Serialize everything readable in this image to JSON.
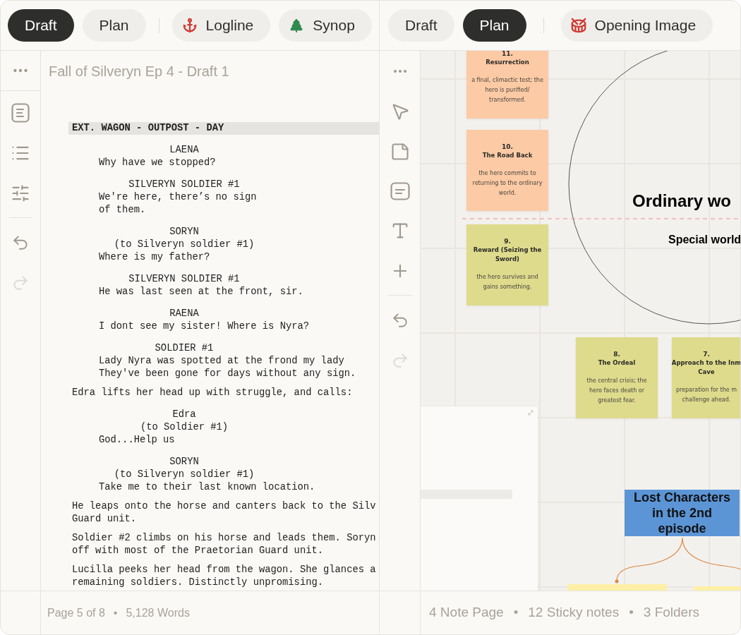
{
  "left_panel": {
    "tabs": [
      {
        "label": "Draft",
        "selected": true
      },
      {
        "label": "Plan",
        "selected": false
      }
    ],
    "chips": [
      {
        "label": "Logline"
      },
      {
        "label": "Synop"
      }
    ],
    "document_title": "Fall of Silveryn Ep 4 - Draft 1",
    "history": [
      {
        "kind": "undo",
        "disabled": false
      },
      {
        "kind": "redo",
        "disabled": true
      }
    ],
    "script": [
      {
        "kind": "heading",
        "text": "EXT. WAGON - OUTPOST - DAY"
      },
      {
        "kind": "speech",
        "character": "LAENA",
        "lines": [
          "Why have we stopped?"
        ]
      },
      {
        "kind": "speech",
        "character": "SILVERYN SOLDIER #1",
        "lines": [
          "We're here, there’s no sign",
          "of them."
        ]
      },
      {
        "kind": "speech",
        "character": "SORYN",
        "parenthetical": "(to Silveryn soldier #1)",
        "lines": [
          "Where is my father?"
        ]
      },
      {
        "kind": "speech",
        "character": "SILVERYN SOLDIER #1",
        "lines": [
          "He was last seen at the front, sir."
        ]
      },
      {
        "kind": "speech",
        "character": "RAENA",
        "lines": [
          "I dont see my sister! Where is Nyra?"
        ]
      },
      {
        "kind": "speech",
        "character": "SOLDIER #1",
        "lines": [
          "Lady Nyra was spotted at the frond my lady",
          "They've been gone for days without any sign."
        ]
      },
      {
        "kind": "action",
        "lines": [
          "Edra lifts her head up with struggle, and calls:"
        ]
      },
      {
        "kind": "speech",
        "character": "Edra",
        "parenthetical": "(to Soldier #1)",
        "lines": [
          "God...Help us"
        ]
      },
      {
        "kind": "speech",
        "character": "SORYN",
        "parenthetical": "(to Silveryn soldier #1)",
        "lines": [
          "Take me to their last known location."
        ]
      },
      {
        "kind": "action",
        "lines": [
          "He leaps onto the horse and canters back to the Silv",
          "Guard unit."
        ]
      },
      {
        "kind": "action",
        "lines": [
          "Soldier #2 climbs on his horse and leads them. Soryn",
          "off with most of the Praetorian Guard unit."
        ]
      },
      {
        "kind": "action",
        "lines": [
          "Lucilla peeks her head from the wagon. She glances a",
          "remaining soldiers. Distinctly unpromising."
        ]
      }
    ],
    "status": [
      "Page 5 of 8",
      "5,128 Words"
    ],
    "status_separator": "•"
  },
  "right_panel": {
    "tabs": [
      {
        "label": "Draft",
        "selected": false
      },
      {
        "label": "Plan",
        "selected": true
      }
    ],
    "chips": [
      {
        "label": "Opening Image"
      }
    ],
    "history": [
      {
        "kind": "undo",
        "disabled": false
      },
      {
        "kind": "redo",
        "disabled": true
      }
    ],
    "cards": [
      {
        "number": "11.",
        "title": [
          "Resurrection"
        ],
        "text": [
          "a final, climactic test; the",
          "hero is purified/",
          "transformed."
        ],
        "color": "#fccaa5"
      },
      {
        "number": "10.",
        "title": [
          "The Road Back"
        ],
        "text": [
          "the hero commits to",
          "returning to the ordinary",
          "world."
        ],
        "color": "#fccaa5"
      },
      {
        "number": "9.",
        "title": [
          "Reward (Seizing the",
          "Sword)"
        ],
        "text": [
          "the hero survives and",
          "gains something."
        ],
        "color": "#dedb8d"
      },
      {
        "number": "8.",
        "title": [
          "The Ordeal"
        ],
        "text": [
          "the central crisis; the",
          "hero faces death or",
          "greatest fear."
        ],
        "color": "#dedb8d"
      },
      {
        "number": "7.",
        "title": [
          "Approach to the Inm",
          "Cave"
        ],
        "text": [
          "preparation for the m",
          "challenge ahead."
        ],
        "color": "#dedb8d"
      }
    ],
    "world_labels": [
      "Ordinary wo",
      "Special world"
    ],
    "callout": "Lost Characters in the 2nd episode",
    "status": [
      "4 Note Page",
      "12 Sticky notes",
      "3 Folders"
    ],
    "status_separator": "•"
  }
}
